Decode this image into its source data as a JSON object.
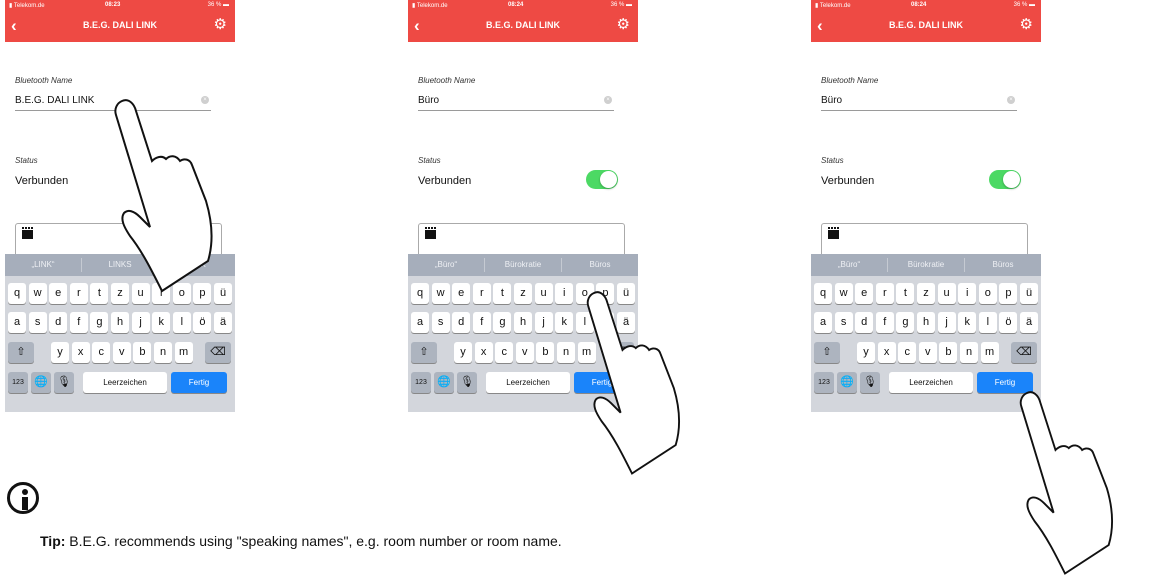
{
  "phones": [
    {
      "carrier": "Telekom.de",
      "time": "08:23",
      "battery": "36 %",
      "title": "B.E.G. DALI LINK",
      "name_label": "Bluetooth Name",
      "name_value": "B.E.G. DALI LINK",
      "status_label": "Status",
      "status_value": "Verbunden",
      "suggestions": [
        "„LINK“",
        "LINKS",
        "LINK"
      ]
    },
    {
      "carrier": "Telekom.de",
      "time": "08:24",
      "battery": "36 %",
      "title": "B.E.G. DALI LINK",
      "name_label": "Bluetooth Name",
      "name_value": "Büro",
      "status_label": "Status",
      "status_value": "Verbunden",
      "suggestions": [
        "„Büro“",
        "Bürokratie",
        "Büros"
      ]
    },
    {
      "carrier": "Telekom.de",
      "time": "08:24",
      "battery": "36 %",
      "title": "B.E.G. DALI LINK",
      "name_label": "Bluetooth Name",
      "name_value": "Büro",
      "status_label": "Status",
      "status_value": "Verbunden",
      "suggestions": [
        "„Büro“",
        "Bürokratie",
        "Büros"
      ]
    }
  ],
  "keyboard": {
    "row1": [
      "q",
      "w",
      "e",
      "r",
      "t",
      "z",
      "u",
      "i",
      "o",
      "p",
      "ü"
    ],
    "row2": [
      "a",
      "s",
      "d",
      "f",
      "g",
      "h",
      "j",
      "k",
      "l",
      "ö",
      "ä"
    ],
    "row3": [
      "y",
      "x",
      "c",
      "v",
      "b",
      "n",
      "m"
    ],
    "numbers_key": "123",
    "space_key": "Leerzeichen",
    "done_key": "Fertig"
  },
  "tip": {
    "label": "Tip:",
    "text": " B.E.G. recommends using \"speaking names\", e.g. room number or room name."
  },
  "colors": {
    "header": "#ee4a44",
    "toggle_on": "#4cd964",
    "done_key": "#1a84fa"
  },
  "icons": [
    "back-chevron-icon",
    "gear-icon",
    "clear-icon",
    "clapperboard-icon",
    "shift-icon",
    "backspace-icon",
    "globe-icon",
    "microphone-icon",
    "info-icon",
    "hand-pointer-icon"
  ]
}
